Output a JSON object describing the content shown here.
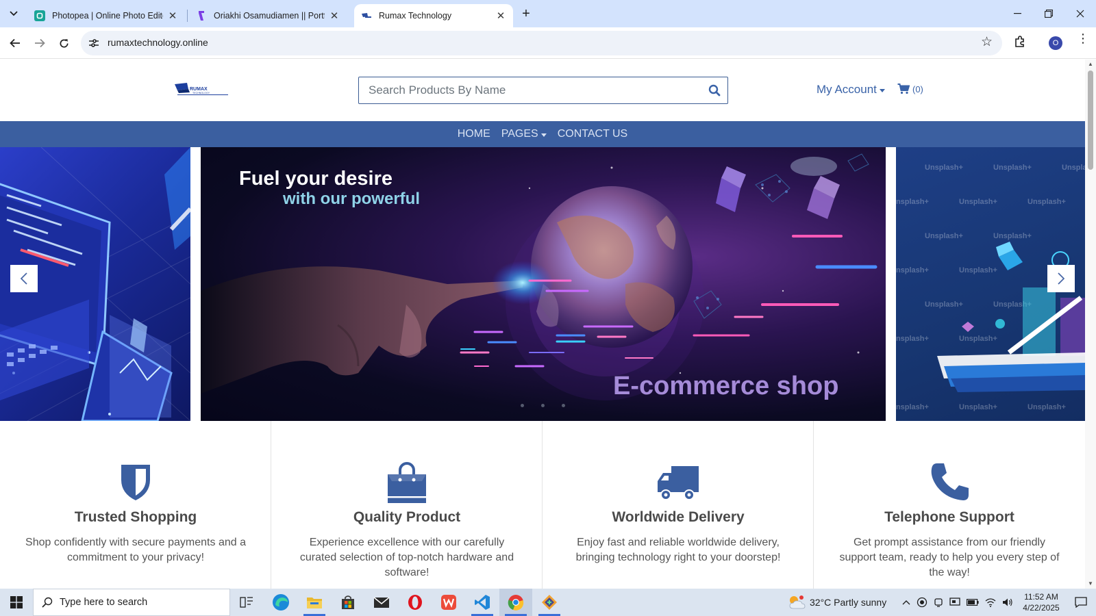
{
  "browser": {
    "tabs": [
      {
        "title": "Photopea | Online Photo Editor",
        "favicon": "photopea-icon",
        "color": "#18a497"
      },
      {
        "title": "Oriakhi Osamudiamen || Portfolio",
        "favicon": "portfolio-icon",
        "color": "#7b3fe4"
      },
      {
        "title": "Rumax Technology",
        "favicon": "rumax-icon",
        "color": "#2d4fa0",
        "active": true
      }
    ],
    "url": "rumaxtechnology.online",
    "profile_initial": "O"
  },
  "site": {
    "logo_text": "RUMAX TECHNOLOGY",
    "search_placeholder": "Search Products By Name",
    "account_label": "My Account",
    "cart_count": "(0)",
    "nav": [
      {
        "label": "HOME"
      },
      {
        "label": "PAGES"
      },
      {
        "label": "CONTACT US"
      }
    ],
    "brand_color": "#3b5fa0",
    "link_color": "#3a63a8"
  },
  "hero": {
    "line1": "Fuel your desire",
    "line2": "with our powerful",
    "line3": "E-commerce shop",
    "watermark": "Unsplash+",
    "slide_count": 3,
    "active_slide": 1
  },
  "features": [
    {
      "icon": "shield-icon",
      "title": "Trusted Shopping",
      "text": "Shop confidently with secure payments and a commitment to your privacy!"
    },
    {
      "icon": "shopping-bag-icon",
      "title": "Quality Product",
      "text": "Experience excellence with our carefully curated selection of top-notch hardware and software!"
    },
    {
      "icon": "truck-icon",
      "title": "Worldwide Delivery",
      "text": "Enjoy fast and reliable worldwide delivery, bringing technology right to your doorstep!"
    },
    {
      "icon": "phone-icon",
      "title": "Telephone Support",
      "text": "Get prompt assistance from our friendly support team, ready to help you every step of the way!"
    }
  ],
  "taskbar": {
    "search_placeholder": "Type here to search",
    "weather": "32°C  Partly sunny",
    "time": "11:52 AM",
    "date": "4/22/2025"
  }
}
